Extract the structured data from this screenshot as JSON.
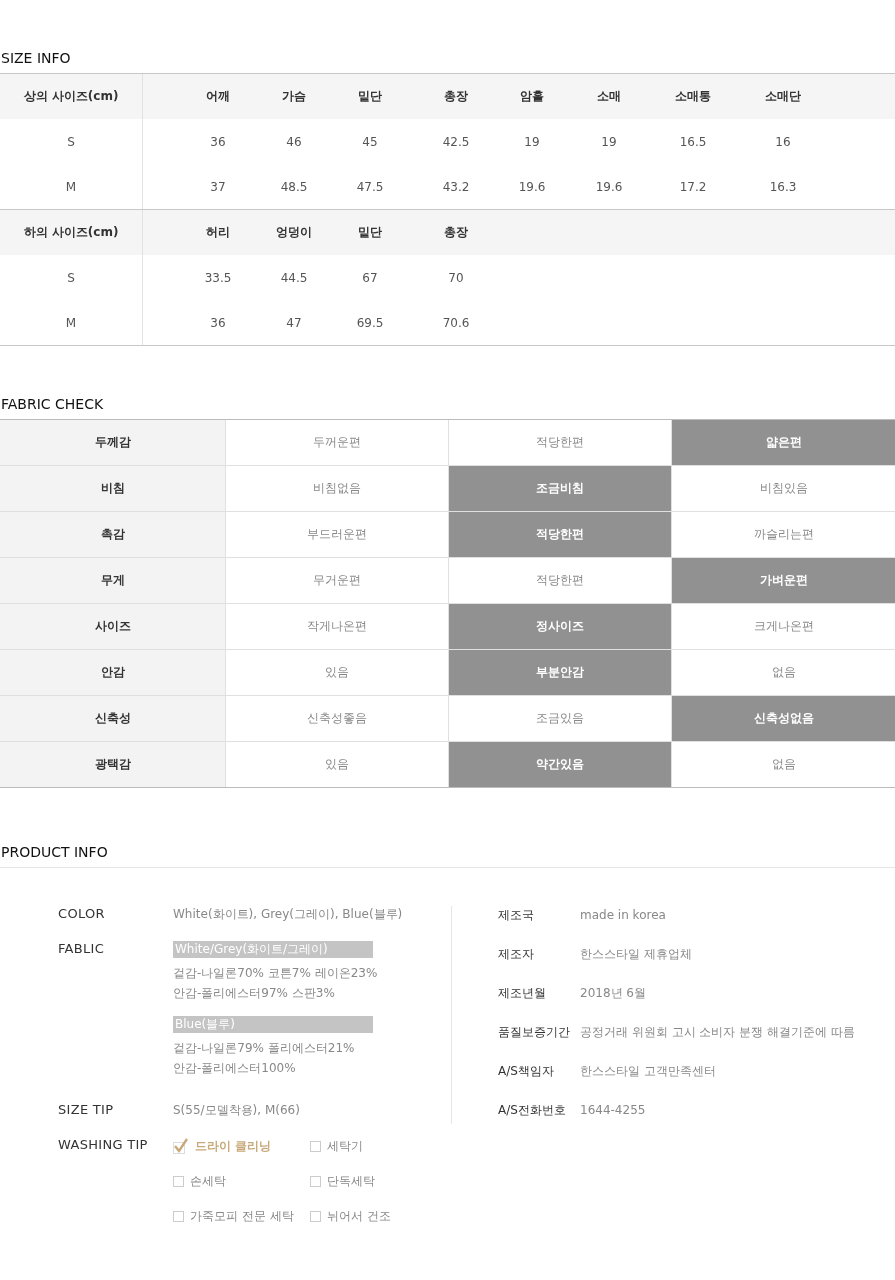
{
  "size_info": {
    "title": "SIZE INFO",
    "tables": [
      {
        "header_label": "상의 사이즈(cm)",
        "columns": [
          "어깨",
          "가슴",
          "밑단",
          "총장",
          "암홀",
          "소매",
          "소매통",
          "소매단"
        ],
        "rows": [
          {
            "size": "S",
            "values": [
              "36",
              "46",
              "45",
              "42.5",
              "19",
              "19",
              "16.5",
              "16"
            ]
          },
          {
            "size": "M",
            "values": [
              "37",
              "48.5",
              "47.5",
              "43.2",
              "19.6",
              "19.6",
              "17.2",
              "16.3"
            ]
          }
        ]
      },
      {
        "header_label": "하의 사이즈(cm)",
        "columns": [
          "허리",
          "엉덩이",
          "밑단",
          "총장"
        ],
        "rows": [
          {
            "size": "S",
            "values": [
              "33.5",
              "44.5",
              "67",
              "70"
            ]
          },
          {
            "size": "M",
            "values": [
              "36",
              "47",
              "69.5",
              "70.6"
            ]
          }
        ]
      }
    ]
  },
  "fabric_check": {
    "title": "FABRIC CHECK",
    "rows": [
      {
        "label": "두께감",
        "options": [
          {
            "text": "두꺼운편",
            "selected": false
          },
          {
            "text": "적당한편",
            "selected": false
          },
          {
            "text": "얇은편",
            "selected": true
          }
        ]
      },
      {
        "label": "비침",
        "options": [
          {
            "text": "비침없음",
            "selected": false
          },
          {
            "text": "조금비침",
            "selected": true
          },
          {
            "text": "비침있음",
            "selected": false
          }
        ]
      },
      {
        "label": "촉감",
        "options": [
          {
            "text": "부드러운편",
            "selected": false
          },
          {
            "text": "적당한편",
            "selected": true
          },
          {
            "text": "까슬리는편",
            "selected": false
          }
        ]
      },
      {
        "label": "무게",
        "options": [
          {
            "text": "무거운편",
            "selected": false
          },
          {
            "text": "적당한편",
            "selected": false
          },
          {
            "text": "가벼운편",
            "selected": true
          }
        ]
      },
      {
        "label": "사이즈",
        "options": [
          {
            "text": "작게나온편",
            "selected": false
          },
          {
            "text": "정사이즈",
            "selected": true
          },
          {
            "text": "크게나온편",
            "selected": false
          }
        ]
      },
      {
        "label": "안감",
        "options": [
          {
            "text": "있음",
            "selected": false
          },
          {
            "text": "부분안감",
            "selected": true
          },
          {
            "text": "없음",
            "selected": false
          }
        ]
      },
      {
        "label": "신축성",
        "options": [
          {
            "text": "신축성좋음",
            "selected": false
          },
          {
            "text": "조금있음",
            "selected": false
          },
          {
            "text": "신축성없음",
            "selected": true
          }
        ]
      },
      {
        "label": "광택감",
        "options": [
          {
            "text": "있음",
            "selected": false
          },
          {
            "text": "약간있음",
            "selected": true
          },
          {
            "text": "없음",
            "selected": false
          }
        ]
      }
    ]
  },
  "product_info": {
    "title": "PRODUCT INFO",
    "color": {
      "label": "COLOR",
      "value": "White(화이트), Grey(그레이), Blue(블루)"
    },
    "fabric": {
      "label": "FABLIC",
      "groups": [
        {
          "name": "White/Grey(화이트/그레이)",
          "lines": [
            "겉감-나일론70% 코튼7% 레이온23%",
            "안감-폴리에스터97% 스판3%"
          ]
        },
        {
          "name": "Blue(블루)",
          "lines": [
            "겉감-나일론79% 폴리에스터21%",
            "안감-폴리에스터100%"
          ]
        }
      ]
    },
    "size_tip": {
      "label": "SIZE TIP",
      "value": "S(55/모델착용), M(66)"
    },
    "washing_tip": {
      "label": "WASHING TIP",
      "options": [
        {
          "text": "드라이 클리닝",
          "checked": true
        },
        {
          "text": "세탁기",
          "checked": false
        },
        {
          "text": "손세탁",
          "checked": false
        },
        {
          "text": "단독세탁",
          "checked": false
        },
        {
          "text": "가죽모피 전문 세탁",
          "checked": false
        },
        {
          "text": "뉘어서 건조",
          "checked": false
        }
      ]
    },
    "details": [
      {
        "label": "제조국",
        "value": "made in korea"
      },
      {
        "label": "제조자",
        "value": "한스스타일 제휴업체"
      },
      {
        "label": "제조년월",
        "value": "2018년 6월"
      },
      {
        "label": "품질보증기간",
        "value": "공정거래 위원회 고시 소비자 분쟁 해결기준에 따름"
      },
      {
        "label": "A/S책임자",
        "value": "한스스타일 고객만족센터"
      },
      {
        "label": "A/S전화번호",
        "value": "1644-4255"
      }
    ]
  }
}
